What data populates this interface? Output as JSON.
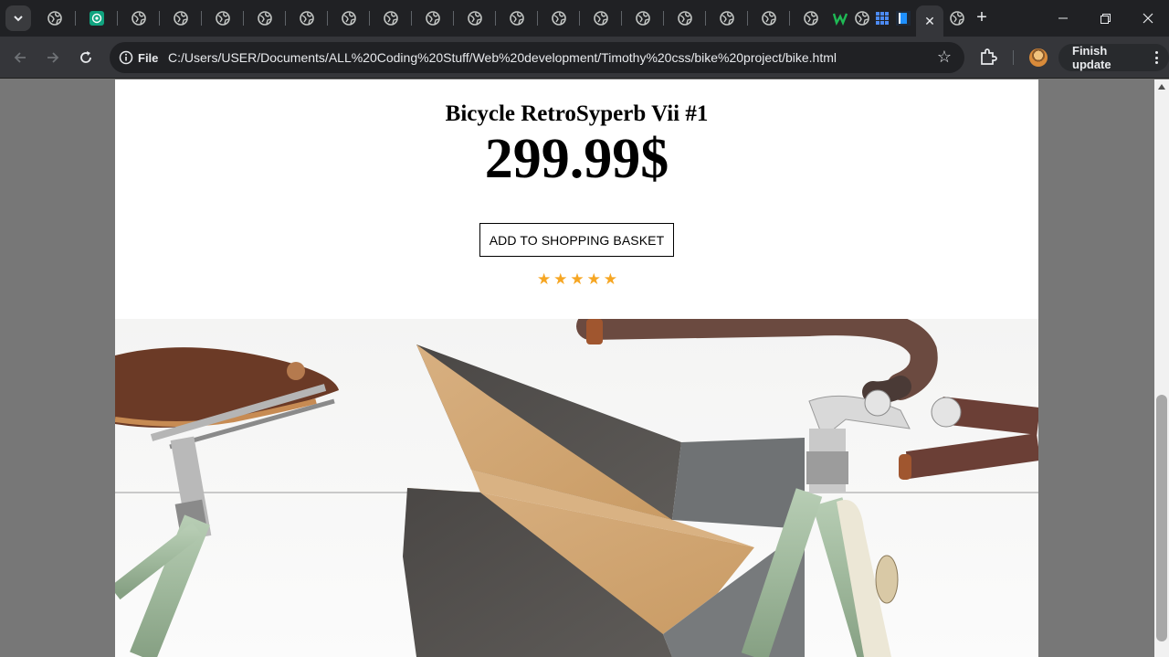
{
  "browser": {
    "close_tab_glyph": "✕",
    "new_tab_glyph": "+",
    "window": {
      "minimize_glyph": "—",
      "restore_glyph": "❐",
      "close_glyph": "✕"
    },
    "address_chip_label": "File",
    "url": "C:/Users/USER/Documents/ALL%20Coding%20Stuff/Web%20development/Timothy%20css/bike%20project/bike.html",
    "bookmark_glyph": "☆",
    "finish_update_label": "Finish update"
  },
  "product": {
    "title": "Bicycle RetroSyperb Vii #1",
    "price": "299.99$",
    "add_button_label": "ADD TO SHOPPING BASKET",
    "star_glyph": "★",
    "rating": 5
  },
  "colors": {
    "star": "#f6a623",
    "page_background": "#777777",
    "chrome_dark": "#202124",
    "frame_green": "#a3bba1",
    "leather_brown": "#6b3a26"
  }
}
